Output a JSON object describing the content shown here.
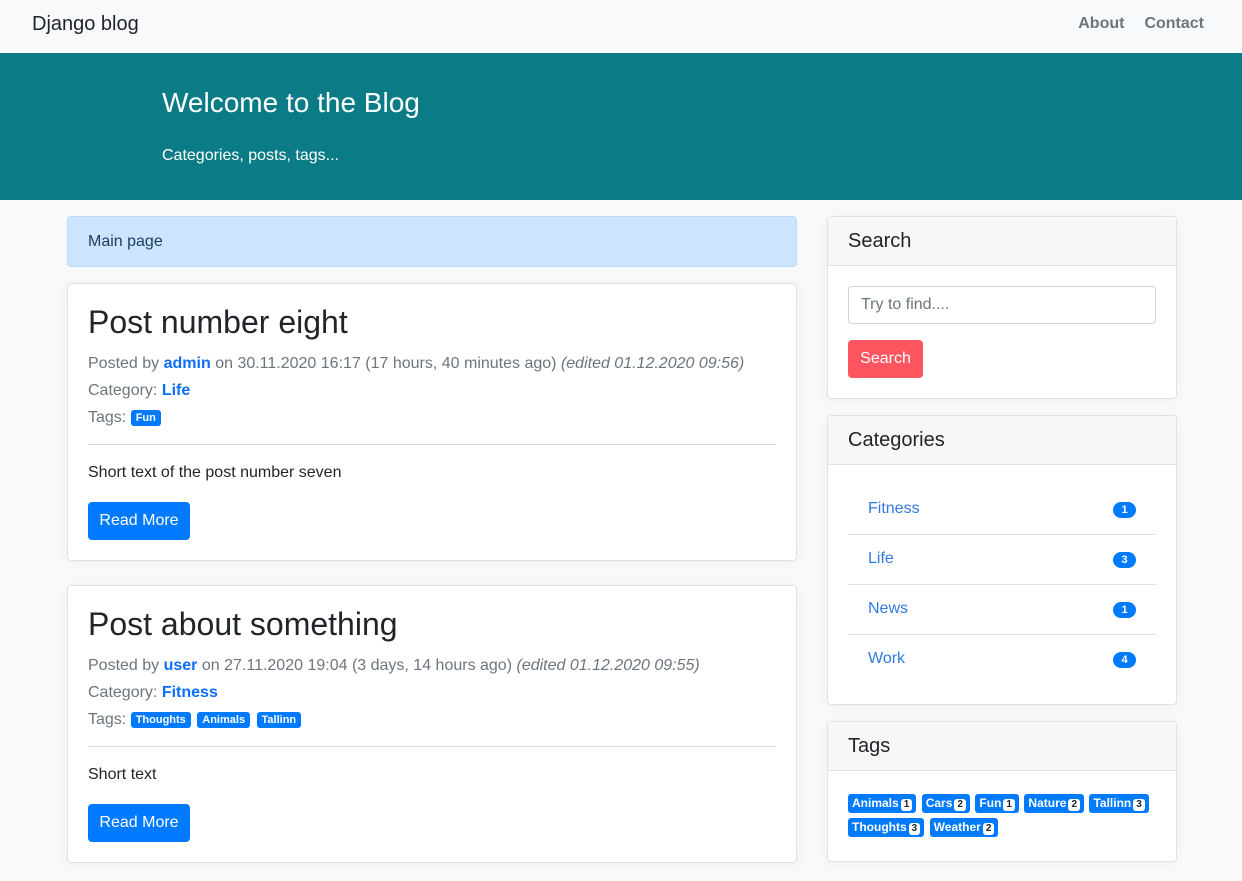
{
  "navbar": {
    "brand": "Django blog",
    "links": [
      "About",
      "Contact"
    ]
  },
  "hero": {
    "title": "Welcome to the Blog",
    "subtitle": "Categories, posts, tags..."
  },
  "breadcrumb": "Main page",
  "labels": {
    "posted_by": "Posted by",
    "on": "on",
    "category": "Category:",
    "tags": "Tags:",
    "read_more": "Read More"
  },
  "posts": [
    {
      "title": "Post number eight",
      "author": "admin",
      "date": "30.11.2020 16:17",
      "ago": "(17 hours, 40 minutes ago)",
      "edited": "(edited 01.12.2020 09:56)",
      "category": "Life",
      "tags": [
        "Fun"
      ],
      "excerpt": "Short text of the post number seven"
    },
    {
      "title": "Post about something",
      "author": "user",
      "date": "27.11.2020 19:04",
      "ago": "(3 days, 14 hours ago)",
      "edited": "(edited 01.12.2020 09:55)",
      "category": "Fitness",
      "tags": [
        "Thoughts",
        "Animals",
        "Tallinn"
      ],
      "excerpt": "Short text"
    }
  ],
  "search": {
    "title": "Search",
    "placeholder": "Try to find....",
    "button": "Search"
  },
  "categories": {
    "title": "Categories",
    "items": [
      {
        "name": "Fitness",
        "count": "1"
      },
      {
        "name": "Life",
        "count": "3"
      },
      {
        "name": "News",
        "count": "1"
      },
      {
        "name": "Work",
        "count": "4"
      }
    ]
  },
  "tags": {
    "title": "Tags",
    "items": [
      {
        "name": "Animals",
        "count": "1"
      },
      {
        "name": "Cars",
        "count": "2"
      },
      {
        "name": "Fun",
        "count": "1"
      },
      {
        "name": "Nature",
        "count": "2"
      },
      {
        "name": "Tallinn",
        "count": "3"
      },
      {
        "name": "Thoughts",
        "count": "3"
      },
      {
        "name": "Weather",
        "count": "2"
      }
    ]
  },
  "colors": {
    "hero": "#0b7c86",
    "primary": "#007bff",
    "search_button": "#ff5560",
    "breadcrumb_bg": "#cce5fd"
  }
}
